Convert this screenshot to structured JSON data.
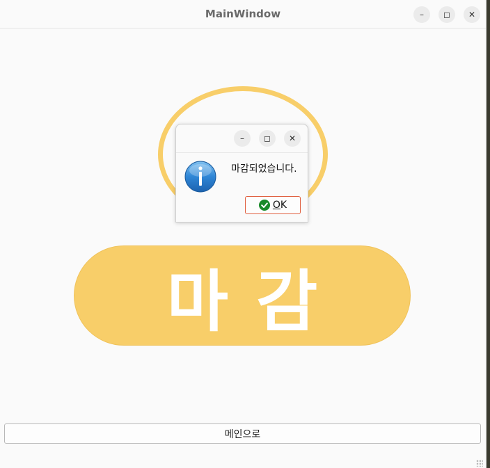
{
  "window": {
    "title": "MainWindow",
    "minimize_glyph": "–",
    "maximize_glyph": "◻",
    "close_glyph": "✕"
  },
  "stamp": {
    "text": "마감",
    "color": "#f8ce69"
  },
  "back_button": {
    "label": "메인으로"
  },
  "dialog": {
    "message": "마감되었습니다.",
    "ok_label_mnemonic": "O",
    "ok_label_rest": "K",
    "icon": "info-icon",
    "minimize_glyph": "–",
    "maximize_glyph": "◻",
    "close_glyph": "✕"
  }
}
